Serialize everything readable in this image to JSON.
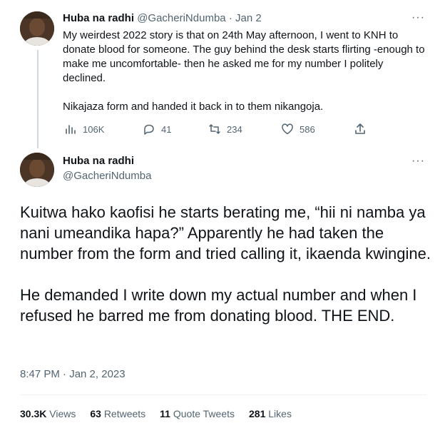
{
  "tweet1": {
    "display_name": "Huba na radhi",
    "handle": "@GacheriNdumba",
    "separator": "·",
    "date": "Jan 2",
    "paragraph1": "My weirdest 2022 story is that on 24th May afternoon, I went to KNH to donate blood for someone. The guy behind the desk starts flirting -enough to make me uncomfortable- then he  asked me for my number I politely declined.",
    "paragraph2": "Nikajaza form and handed it back in to them nikangoja.",
    "more_icon": "···",
    "actions": {
      "views": "106K",
      "replies": "41",
      "retweets": "234",
      "likes": "586"
    }
  },
  "tweet2": {
    "display_name": "Huba na radhi",
    "handle": "@GacheriNdumba",
    "more_icon": "···",
    "paragraph1": "Kuitwa hako kaofisi he starts berating me, “hii ni namba ya nani umeandika hapa?”  Apparently he had taken the number from the form and tried calling it, ikaenda kwingine.",
    "paragraph2": "He demanded I write down my actual number and when I refused he barred me from donating blood. THE END.",
    "timestamp": "8:47 PM · Jan 2, 2023",
    "stats": {
      "views_count": "30.3K",
      "views_label": "Views",
      "retweets_count": "63",
      "retweets_label": "Retweets",
      "quotes_count": "11",
      "quotes_label": "Quote Tweets",
      "likes_count": "281",
      "likes_label": "Likes"
    }
  },
  "colors": {
    "text": "#0f1419",
    "secondary": "#536471",
    "thread_line": "#cfd9de",
    "divider": "#eff3f4"
  }
}
